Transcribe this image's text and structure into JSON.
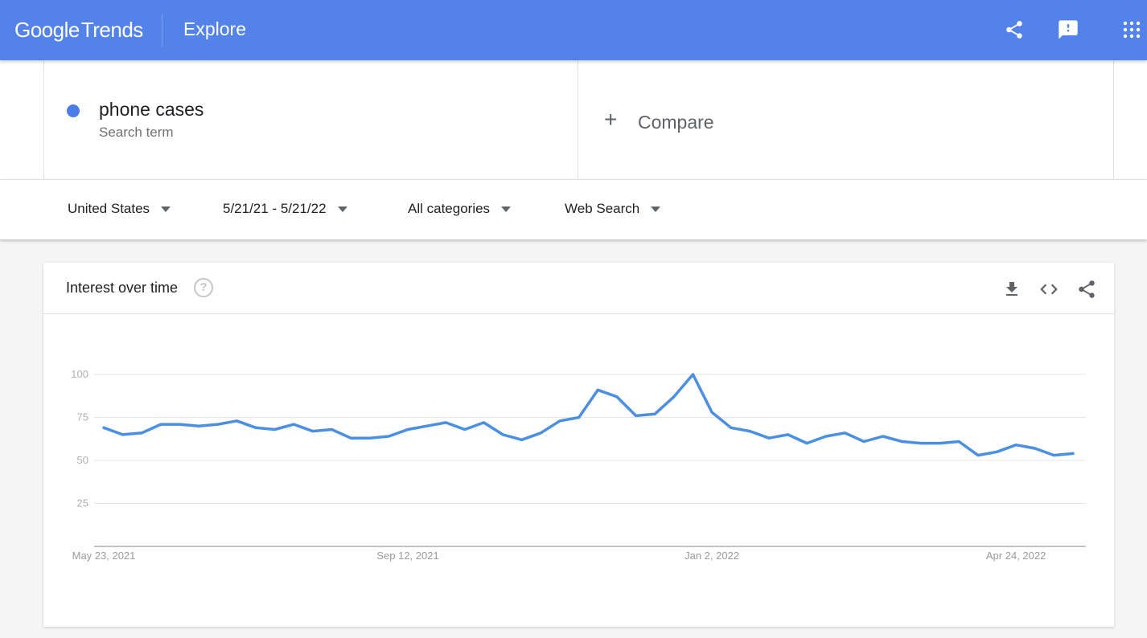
{
  "header": {
    "logo_google": "Google",
    "logo_trends": "Trends",
    "page": "Explore",
    "icons": [
      "share-icon",
      "feedback-icon",
      "apps-grid-icon"
    ]
  },
  "search": {
    "term": "phone cases",
    "term_type": "Search term",
    "term_color": "#4a7ee6",
    "compare_label": "Compare"
  },
  "filters": {
    "region": "United States",
    "date_range": "5/21/21 - 5/21/22",
    "category": "All categories",
    "search_type": "Web Search"
  },
  "card": {
    "title": "Interest over time",
    "help_glyph": "?",
    "actions": [
      "download-icon",
      "embed-code-icon",
      "share-icon"
    ]
  },
  "chart_data": {
    "type": "line",
    "title": "Interest over time",
    "xlabel": "",
    "ylabel": "",
    "ylim": [
      0,
      100
    ],
    "yticks": [
      25,
      50,
      75,
      100
    ],
    "grid": true,
    "line_color": "#4a8fe2",
    "x_tick_labels": [
      {
        "index": 0,
        "label": "May 23, 2021"
      },
      {
        "index": 16,
        "label": "Sep 12, 2021"
      },
      {
        "index": 32,
        "label": "Jan 2, 2022"
      },
      {
        "index": 48,
        "label": "Apr 24, 2022"
      }
    ],
    "series": [
      {
        "name": "phone cases",
        "values": [
          69,
          65,
          66,
          71,
          71,
          70,
          71,
          73,
          69,
          68,
          71,
          67,
          68,
          63,
          63,
          64,
          68,
          70,
          72,
          68,
          72,
          65,
          62,
          66,
          73,
          75,
          91,
          87,
          76,
          77,
          87,
          100,
          78,
          69,
          67,
          63,
          65,
          60,
          64,
          66,
          61,
          64,
          61,
          60,
          60,
          61,
          53,
          55,
          59,
          57,
          53,
          54
        ]
      }
    ]
  }
}
